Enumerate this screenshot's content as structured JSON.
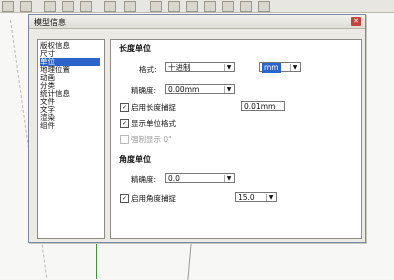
{
  "dialog": {
    "title": "模型信息",
    "close_glyph": "✕"
  },
  "nav": {
    "items": [
      {
        "label": "版权信息",
        "selected": false
      },
      {
        "label": "尺寸",
        "selected": false
      },
      {
        "label": "单位",
        "selected": true
      },
      {
        "label": "地理位置",
        "selected": false
      },
      {
        "label": "动画",
        "selected": false
      },
      {
        "label": "分类",
        "selected": false
      },
      {
        "label": "统计信息",
        "selected": false
      },
      {
        "label": "文件",
        "selected": false
      },
      {
        "label": "文字",
        "selected": false
      },
      {
        "label": "渲染",
        "selected": false
      },
      {
        "label": "组件",
        "selected": false
      }
    ]
  },
  "length_units": {
    "heading": "长度单位",
    "format_label": "格式:",
    "format_value": "十进制",
    "unit_value": "mm",
    "precision_label": "精确度:",
    "precision_value": "0.00mm",
    "enable_snap_label": "启用长度捕捉",
    "enable_snap_checked": true,
    "snap_value": "0.01mm",
    "display_format_label": "显示单位格式",
    "display_format_checked": true,
    "force_display_label": "强制显示 0\"",
    "force_display_checked": false
  },
  "angle_units": {
    "heading": "角度单位",
    "precision_label": "精确度:",
    "precision_value": "0.0",
    "enable_snap_label": "启用角度捕捉",
    "enable_snap_checked": true,
    "snap_value": "15.0"
  },
  "colors": {
    "selection": "#2e63c9",
    "close_button": "#c4433b"
  }
}
